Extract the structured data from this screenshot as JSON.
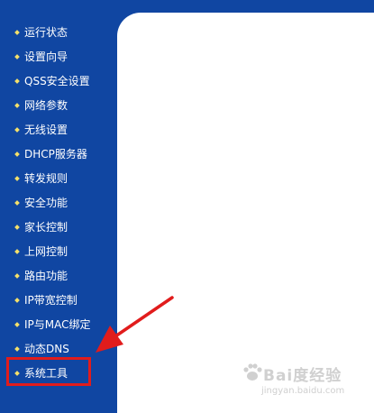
{
  "sidebar": {
    "items": [
      {
        "label": "运行状态"
      },
      {
        "label": "设置向导"
      },
      {
        "label": "QSS安全设置"
      },
      {
        "label": "网络参数"
      },
      {
        "label": "无线设置"
      },
      {
        "label": "DHCP服务器"
      },
      {
        "label": "转发规则"
      },
      {
        "label": "安全功能"
      },
      {
        "label": "家长控制"
      },
      {
        "label": "上网控制"
      },
      {
        "label": "路由功能"
      },
      {
        "label": "IP带宽控制"
      },
      {
        "label": "IP与MAC绑定"
      },
      {
        "label": "动态DNS"
      },
      {
        "label": "系统工具"
      }
    ],
    "highlighted_item": "系统工具"
  },
  "colors": {
    "sidebar_bg": "#1046a2",
    "bullet": "#f4e06a",
    "highlight": "#e11c1c"
  },
  "watermark": {
    "main": "Bai度经验",
    "sub": "jingyan.baidu.com"
  }
}
